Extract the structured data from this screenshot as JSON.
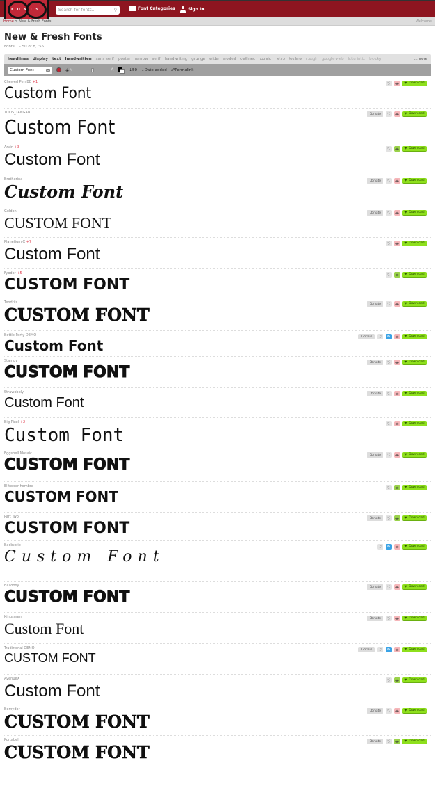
{
  "header": {
    "logo_text": "FONTS",
    "search_placeholder": "Search for fonts...",
    "categories_label": "Font Categories",
    "signin_label": "Sign In"
  },
  "breadcrumb": {
    "home": "Home",
    "separator": ">",
    "current": "New & Fresh Fonts",
    "welcome": "Welcome"
  },
  "page": {
    "title": "New & Fresh Fonts",
    "count": "Fonts 1 - 50 of 8,755"
  },
  "categories": {
    "items": [
      "headlines",
      "display",
      "text",
      "handwritten",
      "sans serif",
      "poster",
      "narrow",
      "serif",
      "handwriting",
      "grunge",
      "wide",
      "eroded",
      "outlined",
      "comic",
      "retro",
      "techno",
      "rough",
      "google web",
      "futuristic",
      "blocky"
    ],
    "more_label": "...more"
  },
  "toolbar": {
    "preview_text": "Custom Font",
    "per_page": "50",
    "sort": "Date added",
    "permalink": "Permalink"
  },
  "labels": {
    "donate": "Donate",
    "download": "Download"
  },
  "fonts": [
    {
      "name": "Chewed Pen BB",
      "extra": "+1",
      "preview": "Custom Font",
      "donate": false,
      "blue": false,
      "tag": "red",
      "style": "f-hand"
    },
    {
      "name": "TULIS_TANGAN",
      "extra": "",
      "preview": "Custom Font",
      "donate": true,
      "blue": false,
      "tag": "red",
      "style": "f-hand"
    },
    {
      "name": "Arvin",
      "extra": "+3",
      "preview": "Custom Font",
      "donate": false,
      "blue": false,
      "tag": "green",
      "style": "f-thin"
    },
    {
      "name": "Brotherina",
      "extra": "",
      "preview": "Custom Font",
      "donate": true,
      "blue": false,
      "tag": "red",
      "style": "f-serif-i"
    },
    {
      "name": "Goldoni",
      "extra": "",
      "preview": "CUSTOM FONT",
      "donate": true,
      "blue": false,
      "tag": "red",
      "style": "f-serif"
    },
    {
      "name": "Planetium-X",
      "extra": "+7",
      "preview": "Custom Font",
      "donate": false,
      "blue": false,
      "tag": "red",
      "style": "f-thin"
    },
    {
      "name": "Fyodor",
      "extra": "+5",
      "preview": "CUSTOM FONT",
      "donate": false,
      "blue": false,
      "tag": "green",
      "style": "f-bold"
    },
    {
      "name": "Tendrils",
      "extra": "",
      "preview": "CUSTOM FONT",
      "donate": true,
      "blue": false,
      "tag": "red",
      "style": "f-pattern"
    },
    {
      "name": "Bottle Party DEMO",
      "extra": "",
      "preview": "Custom Font",
      "donate": true,
      "blue": true,
      "tag": "red",
      "style": "f-bold"
    },
    {
      "name": "Stampy",
      "extra": "",
      "preview": "CUSTOM FONT",
      "donate": true,
      "blue": false,
      "tag": "red",
      "style": "f-outline"
    },
    {
      "name": "Strawobbly",
      "extra": "",
      "preview": "Custom Font",
      "donate": true,
      "blue": false,
      "tag": "red",
      "style": "f-narrow"
    },
    {
      "name": "Big Pixel",
      "extra": "+2",
      "preview": "Custom Font",
      "donate": false,
      "blue": false,
      "tag": "red",
      "style": "f-mono"
    },
    {
      "name": "Eggshell Mosaic",
      "extra": "",
      "preview": "CUSTOM FONT",
      "donate": true,
      "blue": false,
      "tag": "red",
      "style": "f-outline"
    },
    {
      "name": "El tercer hombre",
      "extra": "",
      "preview": "CUSTOM FONT",
      "donate": false,
      "blue": false,
      "tag": "green",
      "style": "f-bold"
    },
    {
      "name": "Part Two",
      "extra": "",
      "preview": "CUSTOM FONT",
      "donate": true,
      "blue": false,
      "tag": "green",
      "style": "f-bold"
    },
    {
      "name": "Badinerie",
      "extra": "",
      "preview": "Custom Font",
      "donate": false,
      "blue": true,
      "tag": "red",
      "style": "f-script"
    },
    {
      "name": "Balloony",
      "extra": "",
      "preview": "CUSTOM FONT",
      "donate": true,
      "blue": false,
      "tag": "red",
      "style": "f-outline"
    },
    {
      "name": "Kingsmen",
      "extra": "",
      "preview": "Custom Font",
      "donate": true,
      "blue": false,
      "tag": "red",
      "style": "f-serif"
    },
    {
      "name": "Tradizional DEMO",
      "extra": "",
      "preview": "CUSTOM FONT",
      "donate": true,
      "blue": true,
      "tag": "red",
      "style": "f-narrow"
    },
    {
      "name": "AvenueX",
      "extra": "",
      "preview": "Custom Font",
      "donate": false,
      "blue": false,
      "tag": "green",
      "style": "f-thin"
    },
    {
      "name": "Bemydor",
      "extra": "",
      "preview": "CUSTOM FONT",
      "donate": true,
      "blue": false,
      "tag": "red",
      "style": "f-pattern"
    },
    {
      "name": "Portabell",
      "extra": "",
      "preview": "CUSTOM FONT",
      "donate": true,
      "blue": false,
      "tag": "green",
      "style": "f-pattern"
    }
  ]
}
